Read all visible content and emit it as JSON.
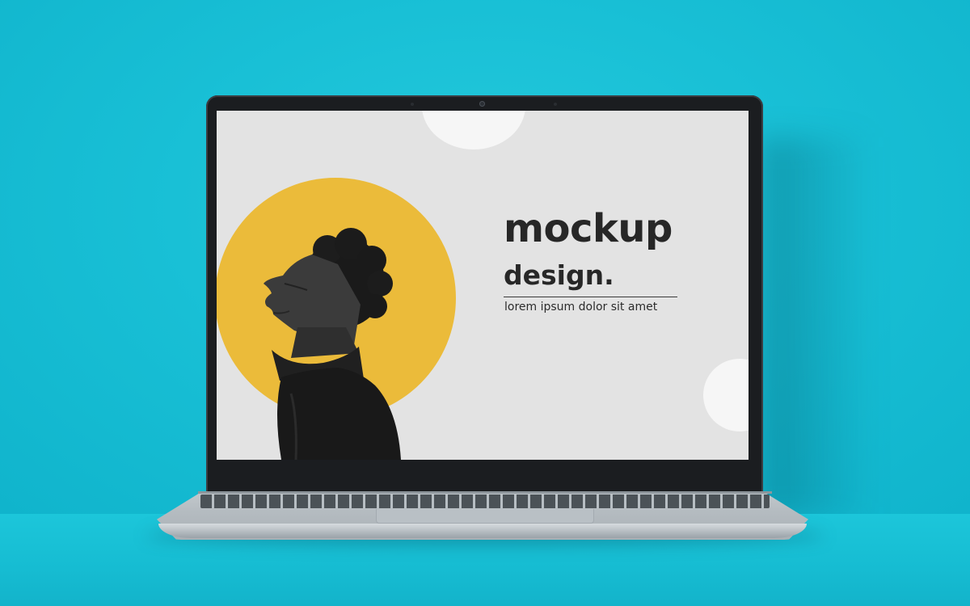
{
  "scene": {
    "wall_color": "#19c0d6",
    "desk_color": "#16bcd2"
  },
  "laptop_screen": {
    "background": "#e3e3e3",
    "accent_yellow": "#ebbb3a",
    "headline_line1": "mockup",
    "headline_line2": "design.",
    "tagline": "lorem ipsum dolor sit amet",
    "hero_image": "person-profile-grayscale"
  }
}
